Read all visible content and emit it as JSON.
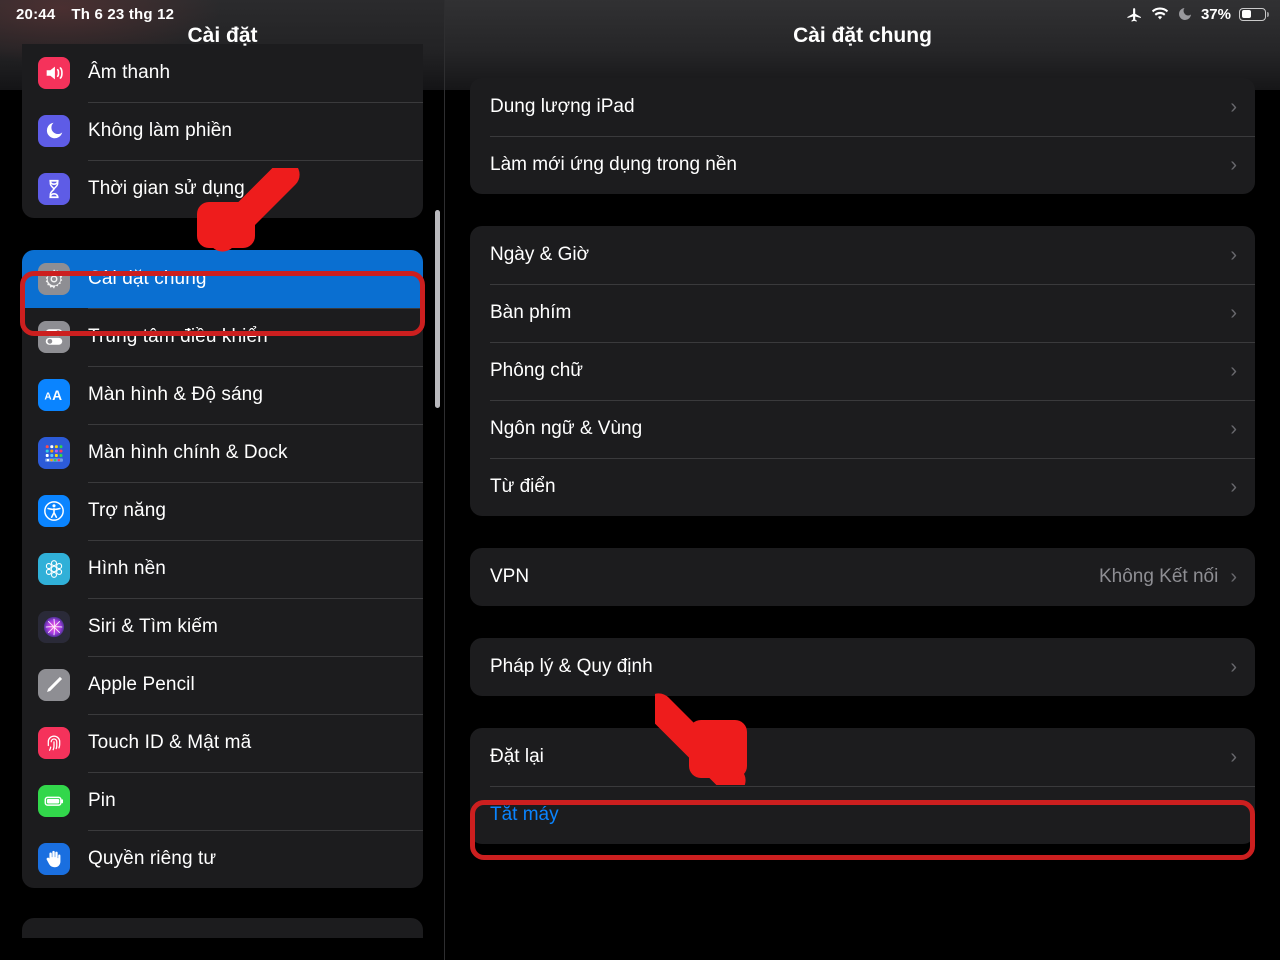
{
  "status_bar": {
    "time": "20:44",
    "date": "Th 6 23 thg 12",
    "battery_percent": "37%",
    "icons": [
      "airplane-mode-icon",
      "wifi-icon",
      "do-not-disturb-icon",
      "battery-icon"
    ]
  },
  "sidebar": {
    "title": "Cài đặt",
    "items": [
      {
        "label": "Âm thanh",
        "icon": "sound-icon",
        "color": "#f5325b",
        "selected": false
      },
      {
        "label": "Không làm phiền",
        "icon": "moon-icon",
        "color": "#5e5ce6",
        "selected": false
      },
      {
        "label": "Thời gian sử dụng",
        "icon": "hourglass-icon",
        "color": "#5e5ce6",
        "selected": false
      },
      {
        "label": "Cài đặt chung",
        "icon": "gear-icon",
        "color": "#8e8e93",
        "selected": true
      },
      {
        "label": "Trung tâm điều khiển",
        "icon": "control-center-icon",
        "color": "#8e8e93",
        "selected": false
      },
      {
        "label": "Màn hình & Độ sáng",
        "icon": "display-brightness-icon",
        "color": "#0a84ff",
        "selected": false
      },
      {
        "label": "Màn hình chính & Dock",
        "icon": "home-screen-dock-icon",
        "color": "#2c5bd8",
        "selected": false
      },
      {
        "label": "Trợ năng",
        "icon": "accessibility-icon",
        "color": "#0a84ff",
        "selected": false
      },
      {
        "label": "Hình nền",
        "icon": "wallpaper-icon",
        "color": "#30b0d8",
        "selected": false
      },
      {
        "label": "Siri & Tìm kiếm",
        "icon": "siri-icon",
        "color": "#2a2a38",
        "selected": false
      },
      {
        "label": "Apple Pencil",
        "icon": "pencil-icon",
        "color": "#8e8e93",
        "selected": false
      },
      {
        "label": "Touch ID & Mật mã",
        "icon": "fingerprint-icon",
        "color": "#f5325b",
        "selected": false
      },
      {
        "label": "Pin",
        "icon": "battery-green-icon",
        "color": "#32d74b",
        "selected": false
      },
      {
        "label": "Quyền riêng tư",
        "icon": "privacy-hand-icon",
        "color": "#1a6fe0",
        "selected": false
      }
    ]
  },
  "detail": {
    "title": "Cài đặt chung",
    "groups": [
      {
        "rows": [
          {
            "label": "Dung lượng iPad",
            "value": "",
            "chevron": "›",
            "style": "normal"
          },
          {
            "label": "Làm mới ứng dụng trong nền",
            "value": "",
            "chevron": "›",
            "style": "normal"
          }
        ]
      },
      {
        "rows": [
          {
            "label": "Ngày & Giờ",
            "value": "",
            "chevron": "›",
            "style": "normal"
          },
          {
            "label": "Bàn phím",
            "value": "",
            "chevron": "›",
            "style": "normal"
          },
          {
            "label": "Phông chữ",
            "value": "",
            "chevron": "›",
            "style": "normal"
          },
          {
            "label": "Ngôn ngữ & Vùng",
            "value": "",
            "chevron": "›",
            "style": "normal"
          },
          {
            "label": "Từ điển",
            "value": "",
            "chevron": "›",
            "style": "normal"
          }
        ]
      },
      {
        "rows": [
          {
            "label": "VPN",
            "value": "Không Kết nối",
            "chevron": "›",
            "style": "normal"
          }
        ]
      },
      {
        "rows": [
          {
            "label": "Pháp lý & Quy định",
            "value": "",
            "chevron": "›",
            "style": "normal"
          }
        ]
      },
      {
        "rows": [
          {
            "label": "Đặt lại",
            "value": "",
            "chevron": "›",
            "style": "normal"
          },
          {
            "label": "Tắt máy",
            "value": "",
            "chevron": "",
            "style": "blue"
          }
        ]
      }
    ]
  },
  "annotations": {
    "highlight_color": "#cc1f1f",
    "arrow_color": "#ee1c1c",
    "highlights": [
      {
        "name": "highlight-cai-dat-chung",
        "target": "Cài đặt chung"
      },
      {
        "name": "highlight-dat-lai",
        "target": "Đặt lại"
      }
    ],
    "arrows": [
      {
        "name": "arrow-to-cai-dat-chung",
        "direction": "down-left"
      },
      {
        "name": "arrow-to-dat-lai",
        "direction": "down-right"
      }
    ]
  }
}
